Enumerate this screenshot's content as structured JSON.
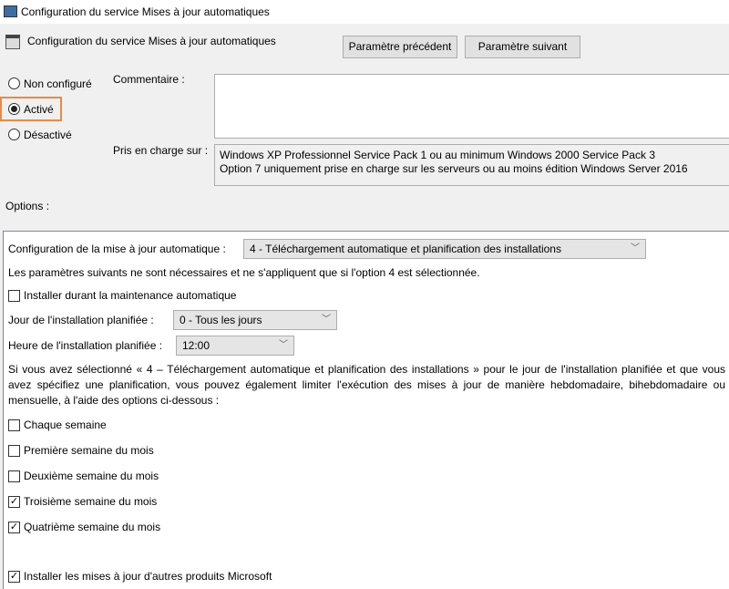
{
  "window": {
    "title": "Configuration du service Mises à jour automatiques"
  },
  "header": {
    "policy_title": "Configuration du service Mises à jour automatiques",
    "prev_button": "Paramètre précédent",
    "next_button": "Paramètre suivant"
  },
  "state": {
    "options": [
      "Non configuré",
      "Activé",
      "Désactivé"
    ],
    "selected": "Activé",
    "highlight_color": "#f0883e"
  },
  "comment": {
    "label": "Commentaire :",
    "value": ""
  },
  "supported": {
    "label": "Pris en charge sur :",
    "lines": [
      "Windows XP Professionnel Service Pack 1 ou au minimum Windows 2000 Service Pack 3",
      "Option 7 uniquement prise en charge sur les serveurs ou au moins édition Windows Server 2016"
    ]
  },
  "options_label": "Options :",
  "options": {
    "config_label": "Configuration de la mise à jour automatique :",
    "config_value": "4 - Téléchargement automatique et planification des installations",
    "note": "Les paramètres suivants ne sont nécessaires et ne s'appliquent que si l'option 4 est sélectionnée.",
    "maintenance": {
      "label": "Installer durant la maintenance automatique",
      "checked": false
    },
    "day_label": "Jour de l'installation planifiée :",
    "day_value": "0 - Tous les jours",
    "time_label": "Heure de l'installation planifiée :",
    "time_value": "12:00",
    "info": [
      "Si vous avez sélectionné « 4 – Téléchargement automatique et planification des installations » pour le jour de l'installation planifiée et que vous avez",
      "spécifiez une planification, vous pouvez également limiter l'exécution des mises à jour de manière hebdomadaire, bihebdomadaire ou mensuelle, à",
      "l'aide des options ci-dessous :"
    ],
    "weeks": [
      {
        "label": "Chaque semaine",
        "checked": false
      },
      {
        "label": "Première semaine du mois",
        "checked": false
      },
      {
        "label": "Deuxième semaine du mois",
        "checked": false
      },
      {
        "label": "Troisième semaine du mois",
        "checked": true
      },
      {
        "label": "Quatrième semaine du mois",
        "checked": true
      }
    ],
    "other_products": {
      "label": "Installer les mises à jour d'autres produits Microsoft",
      "checked": true
    }
  }
}
